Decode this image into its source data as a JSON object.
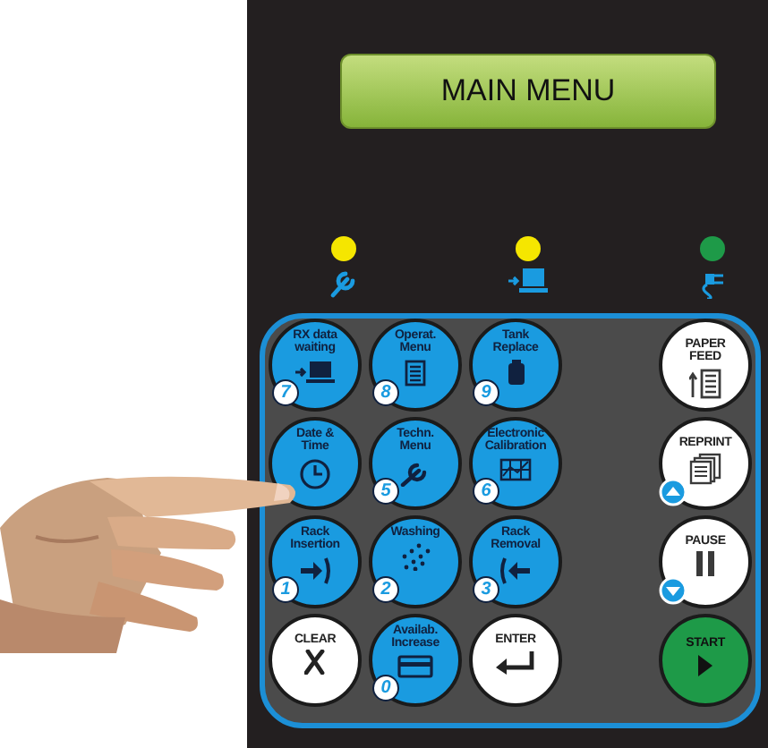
{
  "display": {
    "text": "MAIN MENU"
  },
  "indicators": [
    {
      "color": "#f5e600"
    },
    {
      "color": "#f5e600"
    },
    {
      "color": "#1e9a48"
    }
  ],
  "keys": [
    {
      "kind": "numeric",
      "label": "RX data\nwaiting",
      "number": "7"
    },
    {
      "kind": "numeric",
      "label": "Operat.\nMenu",
      "number": "8"
    },
    {
      "kind": "numeric",
      "label": "Tank\nReplace",
      "number": "9"
    },
    {
      "kind": "function",
      "label": "PAPER\nFEED"
    },
    {
      "kind": "numeric",
      "label": "Date &\nTime"
    },
    {
      "kind": "numeric",
      "label": "Techn.\nMenu",
      "number": "5"
    },
    {
      "kind": "numeric",
      "label": "Electronic\nCalibration",
      "number": "6"
    },
    {
      "kind": "function",
      "label": "REPRINT"
    },
    {
      "kind": "numeric",
      "label": "Rack\nInsertion",
      "number": "1"
    },
    {
      "kind": "numeric",
      "label": "Washing",
      "number": "2"
    },
    {
      "kind": "numeric",
      "label": "Rack\nRemoval",
      "number": "3"
    },
    {
      "kind": "function",
      "label": "PAUSE"
    },
    {
      "kind": "function",
      "label": "CLEAR"
    },
    {
      "kind": "numeric",
      "label": "Availab.\nIncrease",
      "number": "0"
    },
    {
      "kind": "function",
      "label": "ENTER"
    },
    {
      "kind": "start",
      "label": "START"
    }
  ]
}
